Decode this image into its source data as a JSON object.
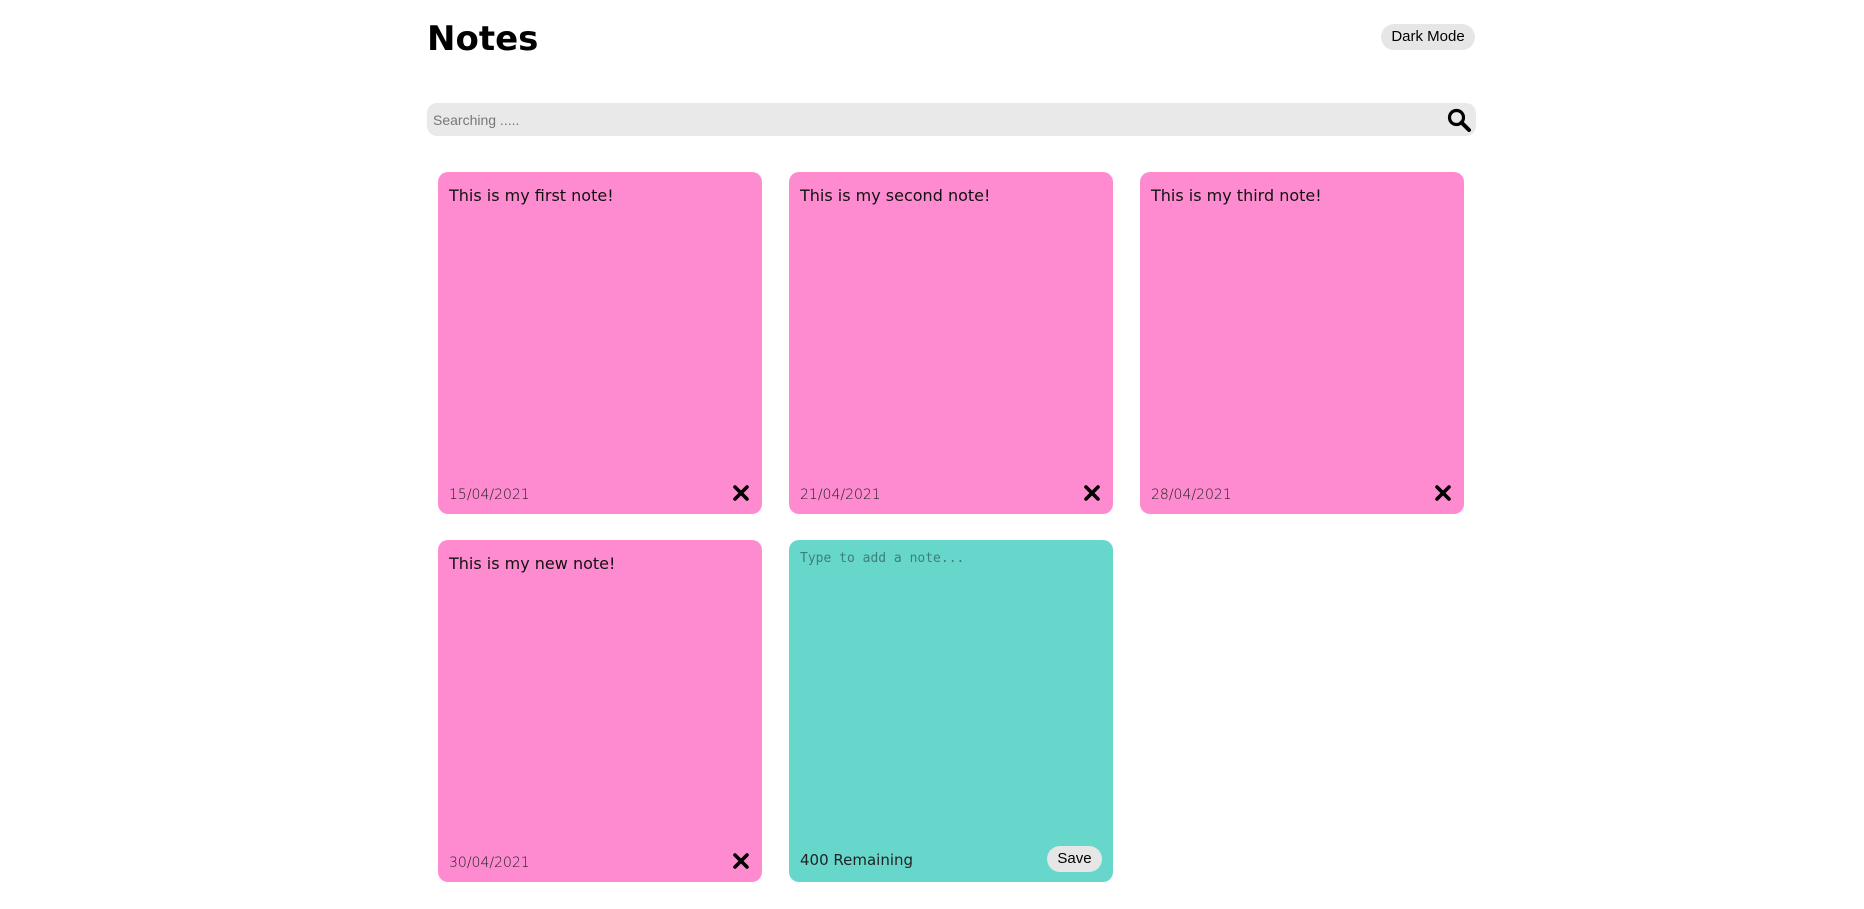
{
  "header": {
    "title": "Notes",
    "dark_mode_label": "Dark Mode"
  },
  "search": {
    "placeholder": "Searching .....",
    "icon": "search-icon"
  },
  "notes": [
    {
      "text": "This is my first note!",
      "date": "15/04/2021",
      "delete_icon": "close-icon"
    },
    {
      "text": "This is my second note!",
      "date": "21/04/2021",
      "delete_icon": "close-icon"
    },
    {
      "text": "This is my third note!",
      "date": "28/04/2021",
      "delete_icon": "close-icon"
    },
    {
      "text": "This is my new note!",
      "date": "30/04/2021",
      "delete_icon": "close-icon"
    }
  ],
  "add_note": {
    "placeholder": "Type to add a note...",
    "remaining": "400 Remaining",
    "save_label": "Save"
  },
  "colors": {
    "note_background": "#fe8bcf",
    "new_note_background": "#67d7cc",
    "search_background": "#e9e9e9",
    "button_background": "#e6e6e6"
  }
}
